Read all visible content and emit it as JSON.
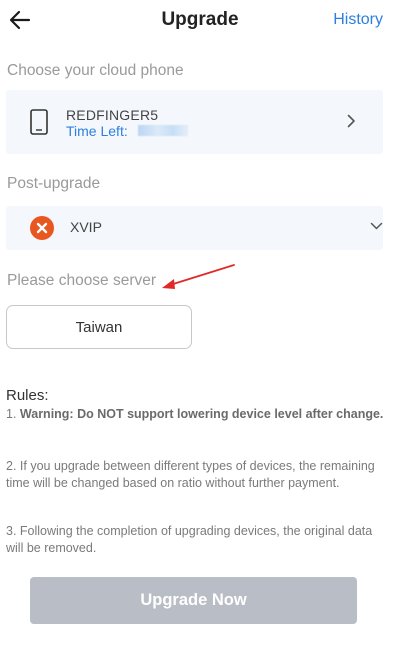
{
  "header": {
    "title": "Upgrade",
    "history_label": "History"
  },
  "phone_section": {
    "label": "Choose your cloud phone",
    "phone_name": "REDFINGER5",
    "time_left_label": "Time Left:"
  },
  "post_upgrade": {
    "label": "Post-upgrade",
    "level": "XVIP"
  },
  "server": {
    "label": "Please choose server",
    "selected": "Taiwan"
  },
  "rules": {
    "title": "Rules:",
    "rule1_prefix": "1. ",
    "rule1_bold": "Warning: Do NOT support lowering device level after change.",
    "rule2": "2. If you upgrade between different types of devices, the remaining time will be changed based on ratio without further payment.",
    "rule3": "3. Following the completion of upgrading devices, the original data will be removed."
  },
  "actions": {
    "upgrade_label": "Upgrade Now"
  },
  "colors": {
    "accent": "#2d80e0",
    "vip_badge": "#e8571f",
    "annotation": "#e02a2a",
    "disabled_button": "#b9bdc5"
  }
}
